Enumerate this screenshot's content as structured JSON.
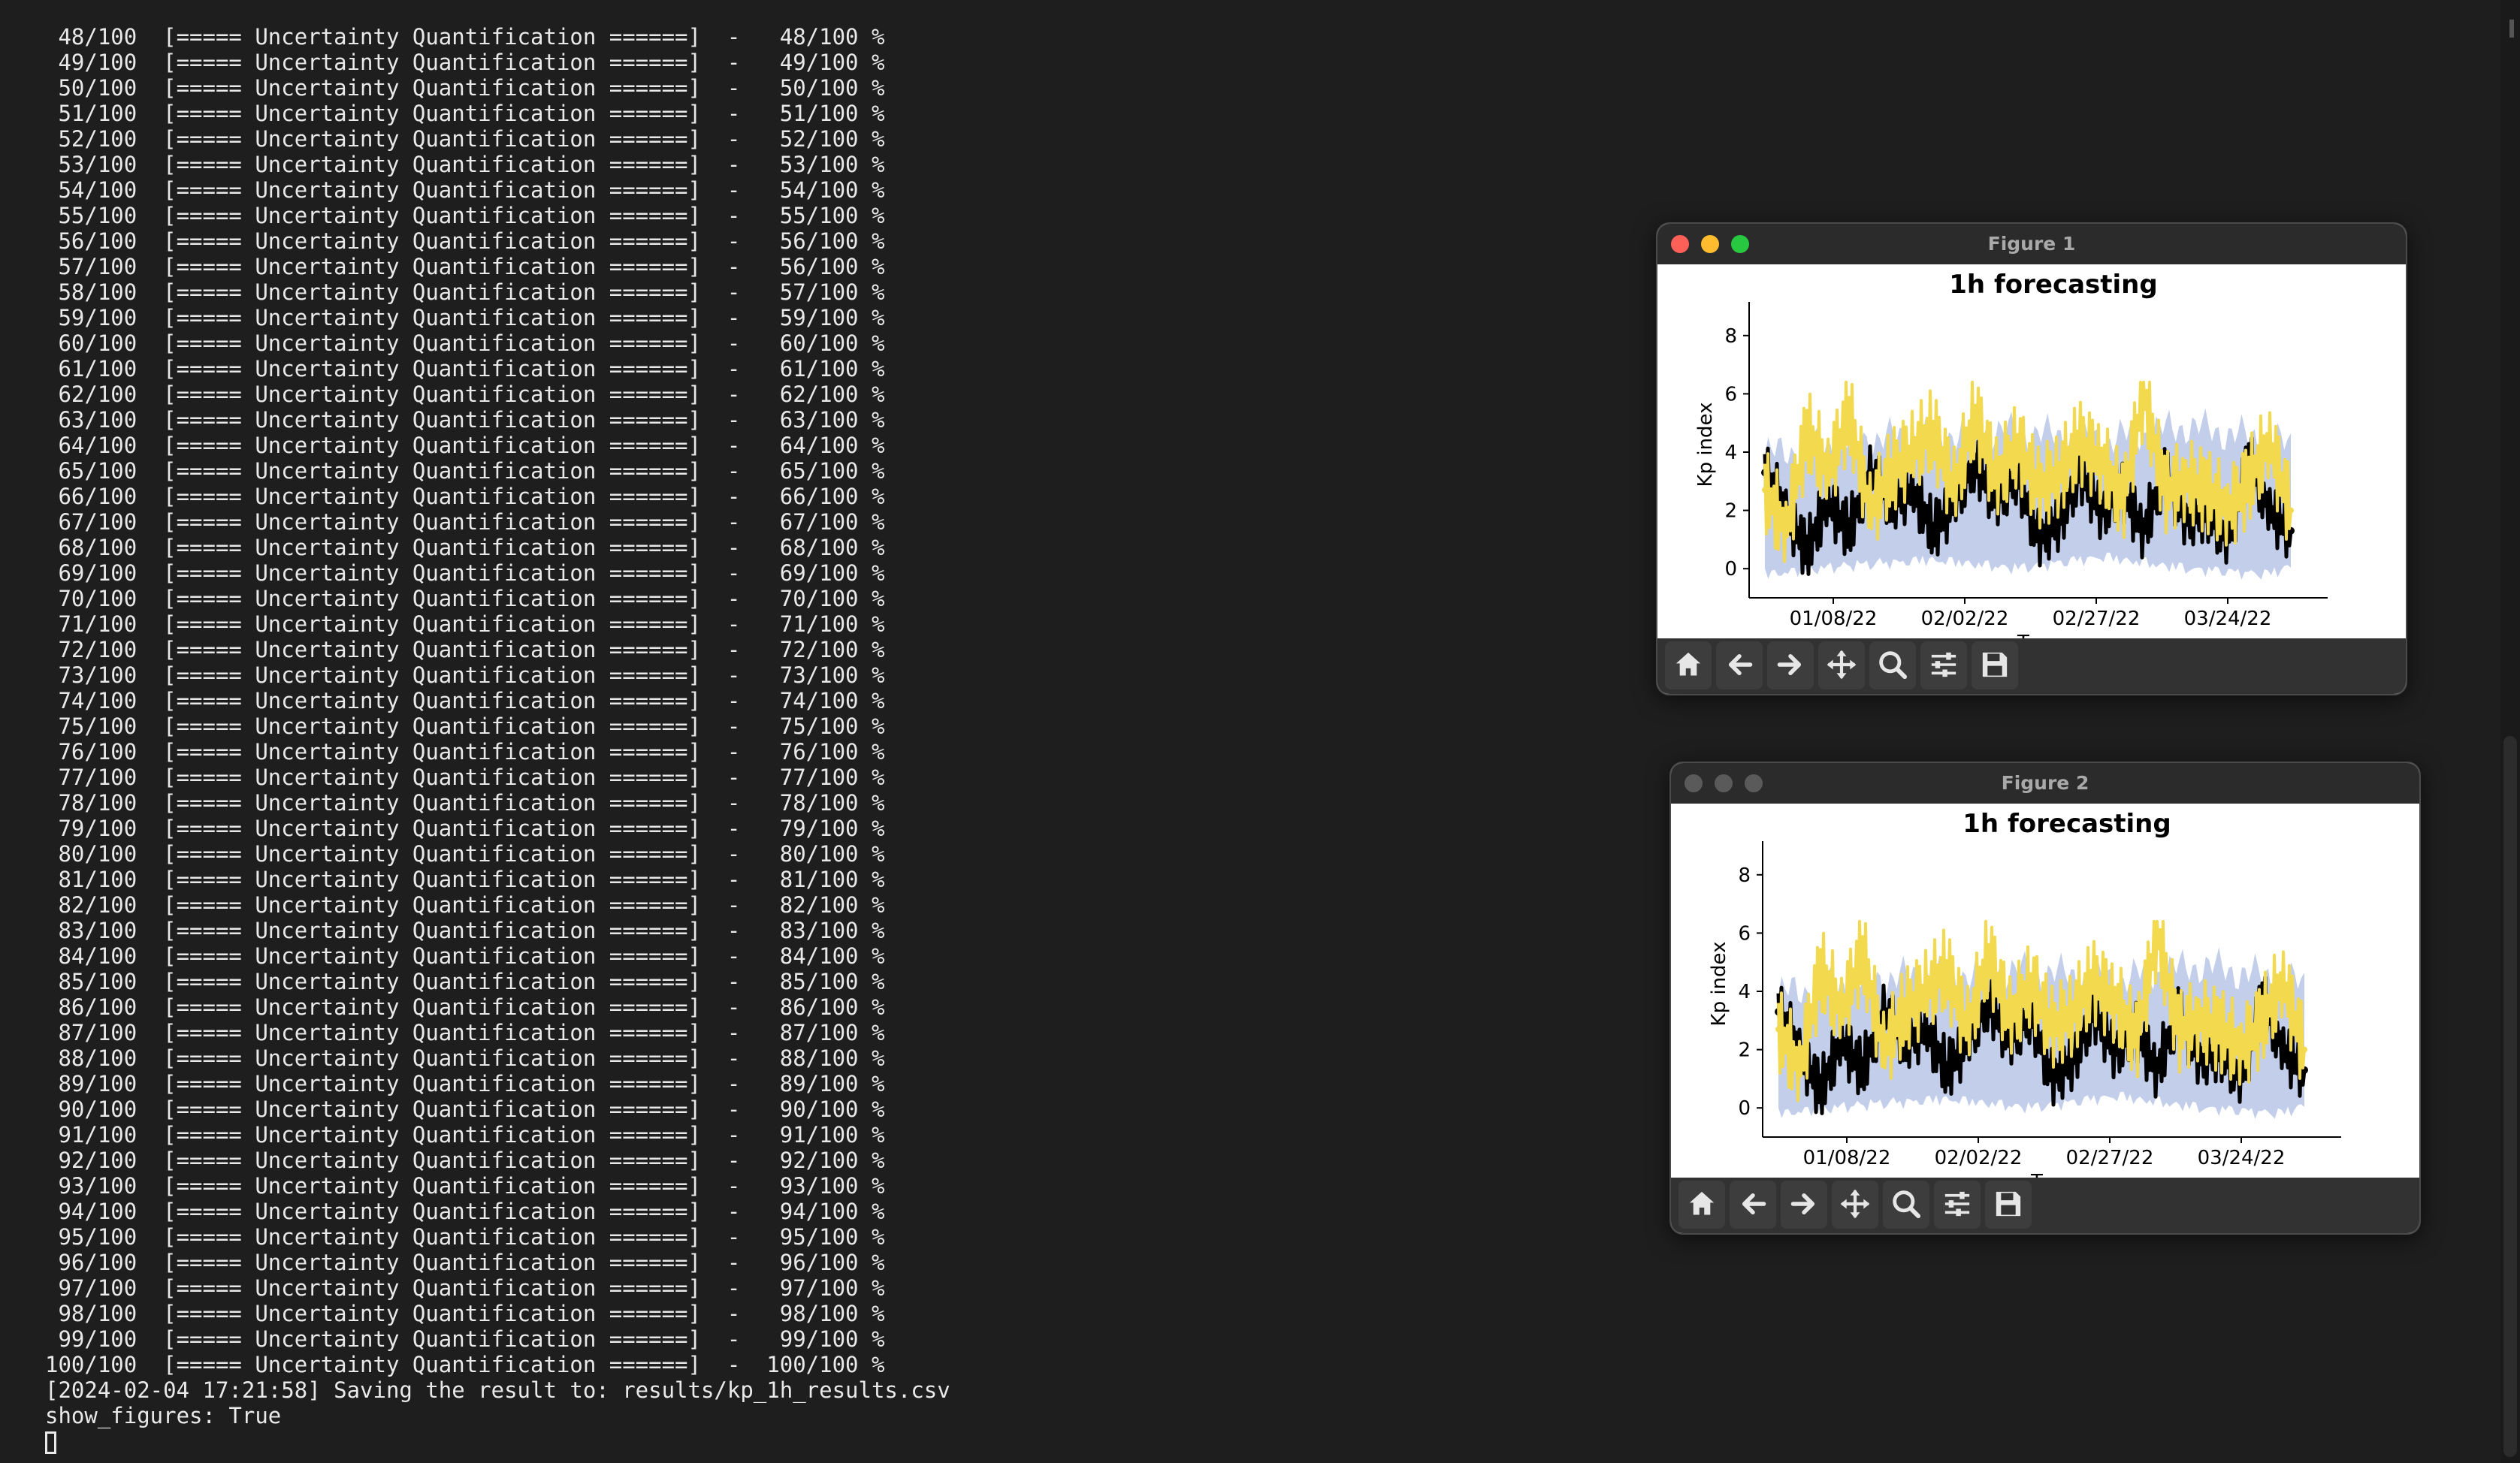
{
  "terminal": {
    "lines": [
      " 48/100  [===== Uncertainty Quantification ======]  -   48/100 %",
      " 49/100  [===== Uncertainty Quantification ======]  -   49/100 %",
      " 50/100  [===== Uncertainty Quantification ======]  -   50/100 %",
      " 51/100  [===== Uncertainty Quantification ======]  -   51/100 %",
      " 52/100  [===== Uncertainty Quantification ======]  -   52/100 %",
      " 53/100  [===== Uncertainty Quantification ======]  -   53/100 %",
      " 54/100  [===== Uncertainty Quantification ======]  -   54/100 %",
      " 55/100  [===== Uncertainty Quantification ======]  -   55/100 %",
      " 56/100  [===== Uncertainty Quantification ======]  -   56/100 %",
      " 57/100  [===== Uncertainty Quantification ======]  -   56/100 %",
      " 58/100  [===== Uncertainty Quantification ======]  -   57/100 %",
      " 59/100  [===== Uncertainty Quantification ======]  -   59/100 %",
      " 60/100  [===== Uncertainty Quantification ======]  -   60/100 %",
      " 61/100  [===== Uncertainty Quantification ======]  -   61/100 %",
      " 62/100  [===== Uncertainty Quantification ======]  -   62/100 %",
      " 63/100  [===== Uncertainty Quantification ======]  -   63/100 %",
      " 64/100  [===== Uncertainty Quantification ======]  -   64/100 %",
      " 65/100  [===== Uncertainty Quantification ======]  -   65/100 %",
      " 66/100  [===== Uncertainty Quantification ======]  -   66/100 %",
      " 67/100  [===== Uncertainty Quantification ======]  -   67/100 %",
      " 68/100  [===== Uncertainty Quantification ======]  -   68/100 %",
      " 69/100  [===== Uncertainty Quantification ======]  -   69/100 %",
      " 70/100  [===== Uncertainty Quantification ======]  -   70/100 %",
      " 71/100  [===== Uncertainty Quantification ======]  -   71/100 %",
      " 72/100  [===== Uncertainty Quantification ======]  -   72/100 %",
      " 73/100  [===== Uncertainty Quantification ======]  -   73/100 %",
      " 74/100  [===== Uncertainty Quantification ======]  -   74/100 %",
      " 75/100  [===== Uncertainty Quantification ======]  -   75/100 %",
      " 76/100  [===== Uncertainty Quantification ======]  -   76/100 %",
      " 77/100  [===== Uncertainty Quantification ======]  -   77/100 %",
      " 78/100  [===== Uncertainty Quantification ======]  -   78/100 %",
      " 79/100  [===== Uncertainty Quantification ======]  -   79/100 %",
      " 80/100  [===== Uncertainty Quantification ======]  -   80/100 %",
      " 81/100  [===== Uncertainty Quantification ======]  -   81/100 %",
      " 82/100  [===== Uncertainty Quantification ======]  -   82/100 %",
      " 83/100  [===== Uncertainty Quantification ======]  -   83/100 %",
      " 84/100  [===== Uncertainty Quantification ======]  -   84/100 %",
      " 85/100  [===== Uncertainty Quantification ======]  -   85/100 %",
      " 86/100  [===== Uncertainty Quantification ======]  -   86/100 %",
      " 87/100  [===== Uncertainty Quantification ======]  -   87/100 %",
      " 88/100  [===== Uncertainty Quantification ======]  -   88/100 %",
      " 89/100  [===== Uncertainty Quantification ======]  -   89/100 %",
      " 90/100  [===== Uncertainty Quantification ======]  -   90/100 %",
      " 91/100  [===== Uncertainty Quantification ======]  -   91/100 %",
      " 92/100  [===== Uncertainty Quantification ======]  -   92/100 %",
      " 93/100  [===== Uncertainty Quantification ======]  -   93/100 %",
      " 94/100  [===== Uncertainty Quantification ======]  -   94/100 %",
      " 95/100  [===== Uncertainty Quantification ======]  -   95/100 %",
      " 96/100  [===== Uncertainty Quantification ======]  -   96/100 %",
      " 97/100  [===== Uncertainty Quantification ======]  -   97/100 %",
      " 98/100  [===== Uncertainty Quantification ======]  -   98/100 %",
      " 99/100  [===== Uncertainty Quantification ======]  -   99/100 %",
      "100/100  [===== Uncertainty Quantification ======]  -  100/100 %",
      "[2024-02-04 17:21:58] Saving the result to: results/kp_1h_results.csv",
      "show_figures: True"
    ],
    "text_color": "#e9e9e9",
    "background": "#1e1e1e"
  },
  "windows": [
    {
      "title": "Figure 1",
      "state": "active"
    },
    {
      "title": "Figure 2",
      "state": "inactive"
    }
  ],
  "toolbar": [
    {
      "name": "home-icon",
      "label": "Home"
    },
    {
      "name": "back-icon",
      "label": "Back"
    },
    {
      "name": "forward-icon",
      "label": "Forward"
    },
    {
      "name": "pan-icon",
      "label": "Pan"
    },
    {
      "name": "zoom-icon",
      "label": "Zoom"
    },
    {
      "name": "configure-subplots-icon",
      "label": "Configure subplots"
    },
    {
      "name": "save-icon",
      "label": "Save"
    }
  ],
  "chart_data": [
    {
      "type": "line",
      "title": "1h forecasting",
      "xlabel": "T",
      "ylabel": "Kp index",
      "xticklabels": [
        "01/08/22",
        "02/02/22",
        "02/27/22",
        "03/24/22"
      ],
      "yticks": [
        0,
        2,
        4,
        6,
        8
      ],
      "xlim": [
        "2021-12-23",
        "2022-04-12"
      ],
      "ylim": [
        -1,
        9
      ],
      "grid": false,
      "series": [
        {
          "role": "observed",
          "color": "#000000",
          "x": [
            "2021-12-26",
            "2021-12-30",
            "2022-01-03",
            "2022-01-07",
            "2022-01-11",
            "2022-01-15",
            "2022-01-19",
            "2022-01-23",
            "2022-01-27",
            "2022-01-31",
            "2022-02-04",
            "2022-02-08",
            "2022-02-12",
            "2022-02-16",
            "2022-02-20",
            "2022-02-24",
            "2022-02-28",
            "2022-03-04",
            "2022-03-08",
            "2022-03-12",
            "2022-03-16",
            "2022-03-20",
            "2022-03-24",
            "2022-03-28",
            "2022-04-01",
            "2022-04-05"
          ],
          "y": [
            3.3,
            2.0,
            0.6,
            2.3,
            1.3,
            3.3,
            2.3,
            2.7,
            1.3,
            2.3,
            3.7,
            2.3,
            3.3,
            1.0,
            1.7,
            3.3,
            2.0,
            2.7,
            1.3,
            3.3,
            1.7,
            2.0,
            1.0,
            3.7,
            2.0,
            1.3
          ]
        },
        {
          "role": "forecast",
          "color": "#f2d94e",
          "x": [
            "2021-12-26",
            "2021-12-30",
            "2022-01-03",
            "2022-01-07",
            "2022-01-11",
            "2022-01-15",
            "2022-01-19",
            "2022-01-23",
            "2022-01-27",
            "2022-01-31",
            "2022-02-04",
            "2022-02-08",
            "2022-02-12",
            "2022-02-16",
            "2022-02-20",
            "2022-02-24",
            "2022-02-28",
            "2022-03-04",
            "2022-03-08",
            "2022-03-12",
            "2022-03-16",
            "2022-03-20",
            "2022-03-24",
            "2022-03-28",
            "2022-04-01",
            "2022-04-05"
          ],
          "y": [
            2.7,
            1.3,
            4.7,
            3.3,
            5.3,
            2.0,
            3.3,
            4.0,
            4.7,
            2.7,
            5.3,
            3.0,
            4.3,
            2.7,
            3.3,
            4.3,
            3.7,
            2.3,
            6.0,
            2.7,
            3.0,
            2.7,
            2.0,
            3.0,
            4.3,
            2.0
          ]
        },
        {
          "role": "uncertainty band",
          "color": "#b9c6e8",
          "x": [
            "2021-12-26",
            "2022-01-11",
            "2022-01-27",
            "2022-02-12",
            "2022-02-28",
            "2022-03-16",
            "2022-04-01",
            "2022-04-05"
          ],
          "lower": [
            0.0,
            0.3,
            0.5,
            0.2,
            0.6,
            0.2,
            0.0,
            0.3
          ],
          "upper": [
            4.5,
            5.0,
            5.2,
            5.3,
            5.0,
            5.5,
            5.0,
            4.8
          ]
        }
      ]
    },
    {
      "type": "line",
      "title": "1h forecasting",
      "xlabel": "T",
      "ylabel": "Kp index",
      "xticklabels": [
        "01/08/22",
        "02/02/22",
        "02/27/22",
        "03/24/22"
      ],
      "yticks": [
        0,
        2,
        4,
        6,
        8
      ],
      "xlim": [
        "2021-12-23",
        "2022-04-12"
      ],
      "ylim": [
        -1,
        9
      ],
      "grid": false,
      "series": [
        {
          "role": "observed",
          "color": "#000000",
          "x": [
            "2021-12-26",
            "2021-12-30",
            "2022-01-03",
            "2022-01-07",
            "2022-01-11",
            "2022-01-15",
            "2022-01-19",
            "2022-01-23",
            "2022-01-27",
            "2022-01-31",
            "2022-02-04",
            "2022-02-08",
            "2022-02-12",
            "2022-02-16",
            "2022-02-20",
            "2022-02-24",
            "2022-02-28",
            "2022-03-04",
            "2022-03-08",
            "2022-03-12",
            "2022-03-16",
            "2022-03-20",
            "2022-03-24",
            "2022-03-28",
            "2022-04-01",
            "2022-04-05"
          ],
          "y": [
            3.3,
            2.0,
            0.6,
            2.3,
            1.3,
            3.3,
            2.3,
            2.7,
            1.3,
            2.3,
            3.7,
            2.3,
            3.3,
            1.0,
            1.7,
            3.3,
            2.0,
            2.7,
            1.3,
            3.3,
            1.7,
            2.0,
            1.0,
            3.7,
            2.0,
            1.3
          ]
        },
        {
          "role": "forecast",
          "color": "#f2d94e",
          "x": [
            "2021-12-26",
            "2021-12-30",
            "2022-01-03",
            "2022-01-07",
            "2022-01-11",
            "2022-01-15",
            "2022-01-19",
            "2022-01-23",
            "2022-01-27",
            "2022-01-31",
            "2022-02-04",
            "2022-02-08",
            "2022-02-12",
            "2022-02-16",
            "2022-02-20",
            "2022-02-24",
            "2022-02-28",
            "2022-03-04",
            "2022-03-08",
            "2022-03-12",
            "2022-03-16",
            "2022-03-20",
            "2022-03-24",
            "2022-03-28",
            "2022-04-01",
            "2022-04-05"
          ],
          "y": [
            2.7,
            1.3,
            4.7,
            3.3,
            5.3,
            2.0,
            3.3,
            4.0,
            4.7,
            2.7,
            5.3,
            3.0,
            4.3,
            2.7,
            3.3,
            4.3,
            3.7,
            2.3,
            6.0,
            2.7,
            3.0,
            2.7,
            2.0,
            3.0,
            4.3,
            2.0
          ]
        },
        {
          "role": "uncertainty band",
          "color": "#b9c6e8",
          "x": [
            "2021-12-26",
            "2022-01-11",
            "2022-01-27",
            "2022-02-12",
            "2022-02-28",
            "2022-03-16",
            "2022-04-01",
            "2022-04-05"
          ],
          "lower": [
            0.0,
            0.3,
            0.5,
            0.2,
            0.6,
            0.2,
            0.0,
            0.3
          ],
          "upper": [
            4.5,
            5.0,
            5.2,
            5.3,
            5.0,
            5.5,
            5.0,
            4.8
          ]
        }
      ]
    }
  ]
}
